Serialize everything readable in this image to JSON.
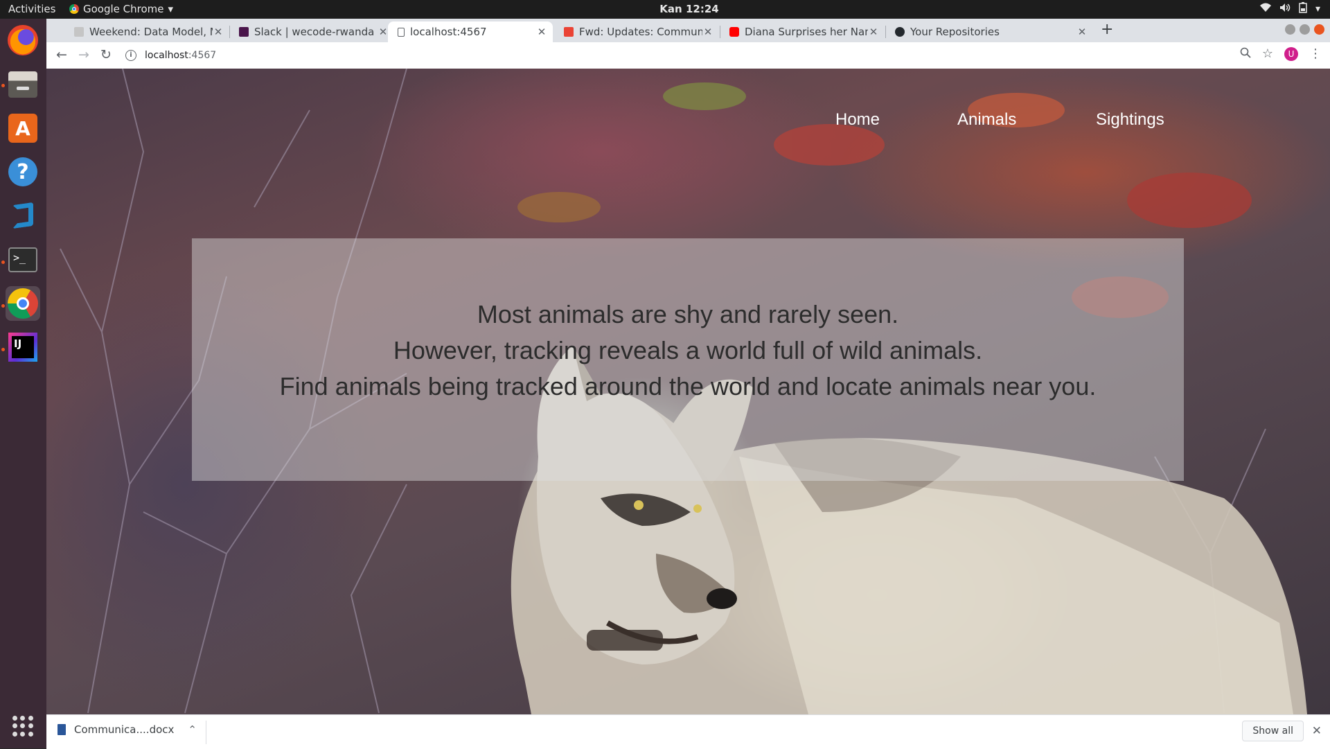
{
  "topbar": {
    "activities": "Activities",
    "app_name": "Google Chrome",
    "clock": "Kan 12:24"
  },
  "dock": {
    "items": [
      "firefox-icon",
      "files-icon",
      "software-store-icon",
      "help-icon",
      "vscode-icon",
      "terminal-icon",
      "chrome-icon",
      "intellij-icon"
    ],
    "show_apps": "app-grid-icon"
  },
  "tabs": [
    {
      "title": "Weekend: Data Model, M",
      "favicon": "mail-icon"
    },
    {
      "title": "Slack | wecode-rwanda | M",
      "favicon": "slack-icon"
    },
    {
      "title": "localhost:4567",
      "favicon": "page-icon",
      "active": true
    },
    {
      "title": "Fwd: Updates: Communic",
      "favicon": "gmail-icon"
    },
    {
      "title": "Diana Surprises her Nann",
      "favicon": "youtube-icon"
    },
    {
      "title": "Your Repositories",
      "favicon": "github-icon"
    }
  ],
  "address": {
    "host": "localhost",
    "port": ":4567"
  },
  "nav": {
    "home": "Home",
    "animals": "Animals",
    "sightings": "Sightings"
  },
  "hero": {
    "line1": "Most animals are shy and rarely seen.",
    "line2": "However, tracking reveals a world full of wild animals.",
    "line3": "Find animals being tracked around the world and locate animals near you."
  },
  "downloads": {
    "file": "Communica....docx",
    "show_all": "Show all"
  },
  "colors": {
    "ubuntu_orange": "#e95420",
    "chrome_tabstrip": "#dee1e6",
    "dock_bg": "#3b2a36"
  }
}
